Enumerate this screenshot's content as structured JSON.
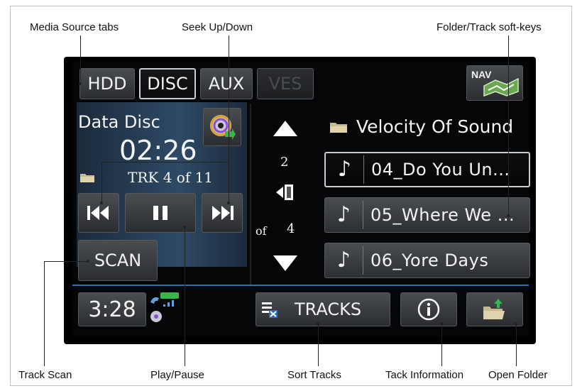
{
  "callouts": {
    "media_source_tabs": "Media Source tabs",
    "seek_up_down": "Seek Up/Down",
    "folder_track_softkeys": "Folder/Track soft-keys",
    "track_scan": "Track Scan",
    "play_pause": "Play/Pause",
    "sort_tracks": "Sort Tracks",
    "track_information": "Tack Information",
    "open_folder": "Open Folder"
  },
  "tabs": [
    {
      "label": "HDD",
      "state": "normal"
    },
    {
      "label": "DISC",
      "state": "active"
    },
    {
      "label": "AUX",
      "state": "normal"
    },
    {
      "label": "VES",
      "state": "disabled"
    }
  ],
  "nav_button": {
    "label": "NAV"
  },
  "now_playing": {
    "source_label": "Data Disc",
    "elapsed_time": "02:26",
    "track_info": "TRK 4 of 11"
  },
  "controls": {
    "prev_icon": "seek-previous-icon",
    "pause_icon": "pause-icon",
    "next_icon": "seek-next-icon",
    "scan_label": "SCAN"
  },
  "list_nav": {
    "page_current": "2",
    "page_of": "of",
    "page_total": "4"
  },
  "folder": {
    "name": "Velocity Of Sound"
  },
  "tracks": [
    {
      "name": "04_Do You Un...",
      "selected": true
    },
    {
      "name": "05_Where We ...",
      "selected": false
    },
    {
      "name": "06_Yore Days",
      "selected": false
    }
  ],
  "bottom_bar": {
    "clock": "3:28",
    "tracks_label": "TRACKS",
    "info_icon": "info-icon",
    "open_folder_icon": "open-folder-icon"
  },
  "colors": {
    "accent_blue": "#2d6fb0",
    "screen_bg": "#050607",
    "button_face": "#4a4d50"
  }
}
